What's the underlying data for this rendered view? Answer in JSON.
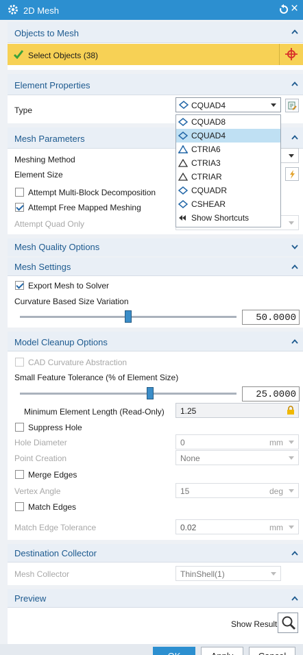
{
  "window": {
    "title": "2D Mesh"
  },
  "objects_to_mesh": {
    "header": "Objects to Mesh",
    "select_label": "Select Objects (38)"
  },
  "element_properties": {
    "header": "Element Properties",
    "type_label": "Type",
    "type_value": "CQUAD4"
  },
  "type_dropdown": {
    "items": [
      {
        "label": "CQUAD8",
        "icon": "quad-icon"
      },
      {
        "label": "CQUAD4",
        "icon": "quad-icon",
        "selected": true
      },
      {
        "label": "CTRIA6",
        "icon": "tria6-icon"
      },
      {
        "label": "CTRIA3",
        "icon": "tria-icon"
      },
      {
        "label": "CTRIAR",
        "icon": "tria-icon"
      },
      {
        "label": "CQUADR",
        "icon": "quad-icon"
      },
      {
        "label": "CSHEAR",
        "icon": "quad-icon"
      },
      {
        "label": "Show Shortcuts",
        "icon": "double-arrow-icon"
      }
    ]
  },
  "mesh_parameters": {
    "header": "Mesh Parameters",
    "meshing_method_label": "Meshing Method",
    "element_size_label": "Element Size",
    "multi_block_label": "Attempt Multi-Block Decomposition",
    "multi_block_checked": false,
    "free_mapped_label": "Attempt Free Mapped Meshing",
    "free_mapped_checked": true,
    "quad_only_label": "Attempt Quad Only"
  },
  "mesh_quality": {
    "header": "Mesh Quality Options"
  },
  "mesh_settings": {
    "header": "Mesh Settings",
    "export_label": "Export Mesh to Solver",
    "export_checked": true,
    "curvature_label": "Curvature Based Size Variation",
    "curvature_value": "50.0000",
    "curvature_fraction": 0.5
  },
  "model_cleanup": {
    "header": "Model Cleanup Options",
    "cad_curvature_label": "CAD Curvature Abstraction",
    "small_feature_label": "Small Feature Tolerance (% of Element Size)",
    "small_feature_value": "25.0000",
    "small_feature_fraction": 0.6,
    "min_length_label": "Minimum Element Length (Read-Only)",
    "min_length_value": "1.25",
    "suppress_hole_label": "Suppress Hole",
    "hole_diameter_label": "Hole Diameter",
    "hole_diameter_value": "0",
    "hole_diameter_unit": "mm",
    "point_creation_label": "Point Creation",
    "point_creation_value": "None",
    "merge_edges_label": "Merge Edges",
    "vertex_angle_label": "Vertex Angle",
    "vertex_angle_value": "15",
    "vertex_angle_unit": "deg",
    "match_edges_label": "Match Edges",
    "match_tol_label": "Match Edge Tolerance",
    "match_tol_value": "0.02",
    "match_tol_unit": "mm"
  },
  "destination": {
    "header": "Destination Collector",
    "collector_label": "Mesh Collector",
    "collector_value": "ThinShell(1)"
  },
  "preview": {
    "header": "Preview",
    "show_result_label": "Show Result"
  },
  "footer": {
    "ok": "OK",
    "apply": "Apply",
    "cancel": "Cancel"
  },
  "colors": {
    "title_bar": "#2c8fd0",
    "select_highlight": "#f7d155",
    "selected_item": "#bfe0f3",
    "header_text": "#1d5a8f"
  }
}
